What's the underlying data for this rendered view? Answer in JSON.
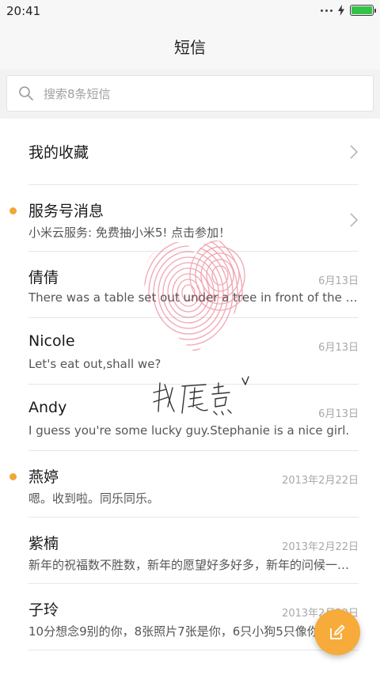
{
  "status_bar": {
    "time": "20:41",
    "battery_level": 1.0,
    "battery_color": "#35c24a"
  },
  "header": {
    "title": "短信"
  },
  "search": {
    "placeholder": "搜索8条短信",
    "icon": "search-icon"
  },
  "favorites": {
    "label": "我的收藏"
  },
  "conversations": [
    {
      "name": "服务号消息",
      "preview": "小米云服务: 免费抽小米5! 点击参加！",
      "date": "",
      "unread": true,
      "chevron": true
    },
    {
      "name": "倩倩",
      "preview": "There was a table set out under a tree in front of the house",
      "date": "6月13日",
      "unread": false,
      "chevron": false
    },
    {
      "name": "Nicole",
      "preview": "Let's eat out,shall we?",
      "date": "6月13日",
      "unread": false,
      "chevron": false
    },
    {
      "name": "Andy",
      "preview": "I guess you're some lucky guy.Stephanie is a nice girl.",
      "date": "6月13日",
      "unread": false,
      "chevron": false
    },
    {
      "name": "燕婷",
      "preview": "嗯。收到啦。同乐同乐。",
      "date": "2013年2月22日",
      "unread": true,
      "chevron": false
    },
    {
      "name": "紫楠",
      "preview": "新年的祝福数不胜数，新年的愿望好多好多，新年的问候一条又一条",
      "date": "2013年2月22日",
      "unread": false,
      "chevron": false
    },
    {
      "name": "子玲",
      "preview": "10分想念9别的你，8张照片7张是你，6只小狗5只像你",
      "date": "2013年2月22日",
      "unread": false,
      "chevron": false
    }
  ],
  "accent_color": "#f7ab3a",
  "unread_dot_color": "#f2a63a",
  "fab": {
    "icon": "compose-icon"
  }
}
